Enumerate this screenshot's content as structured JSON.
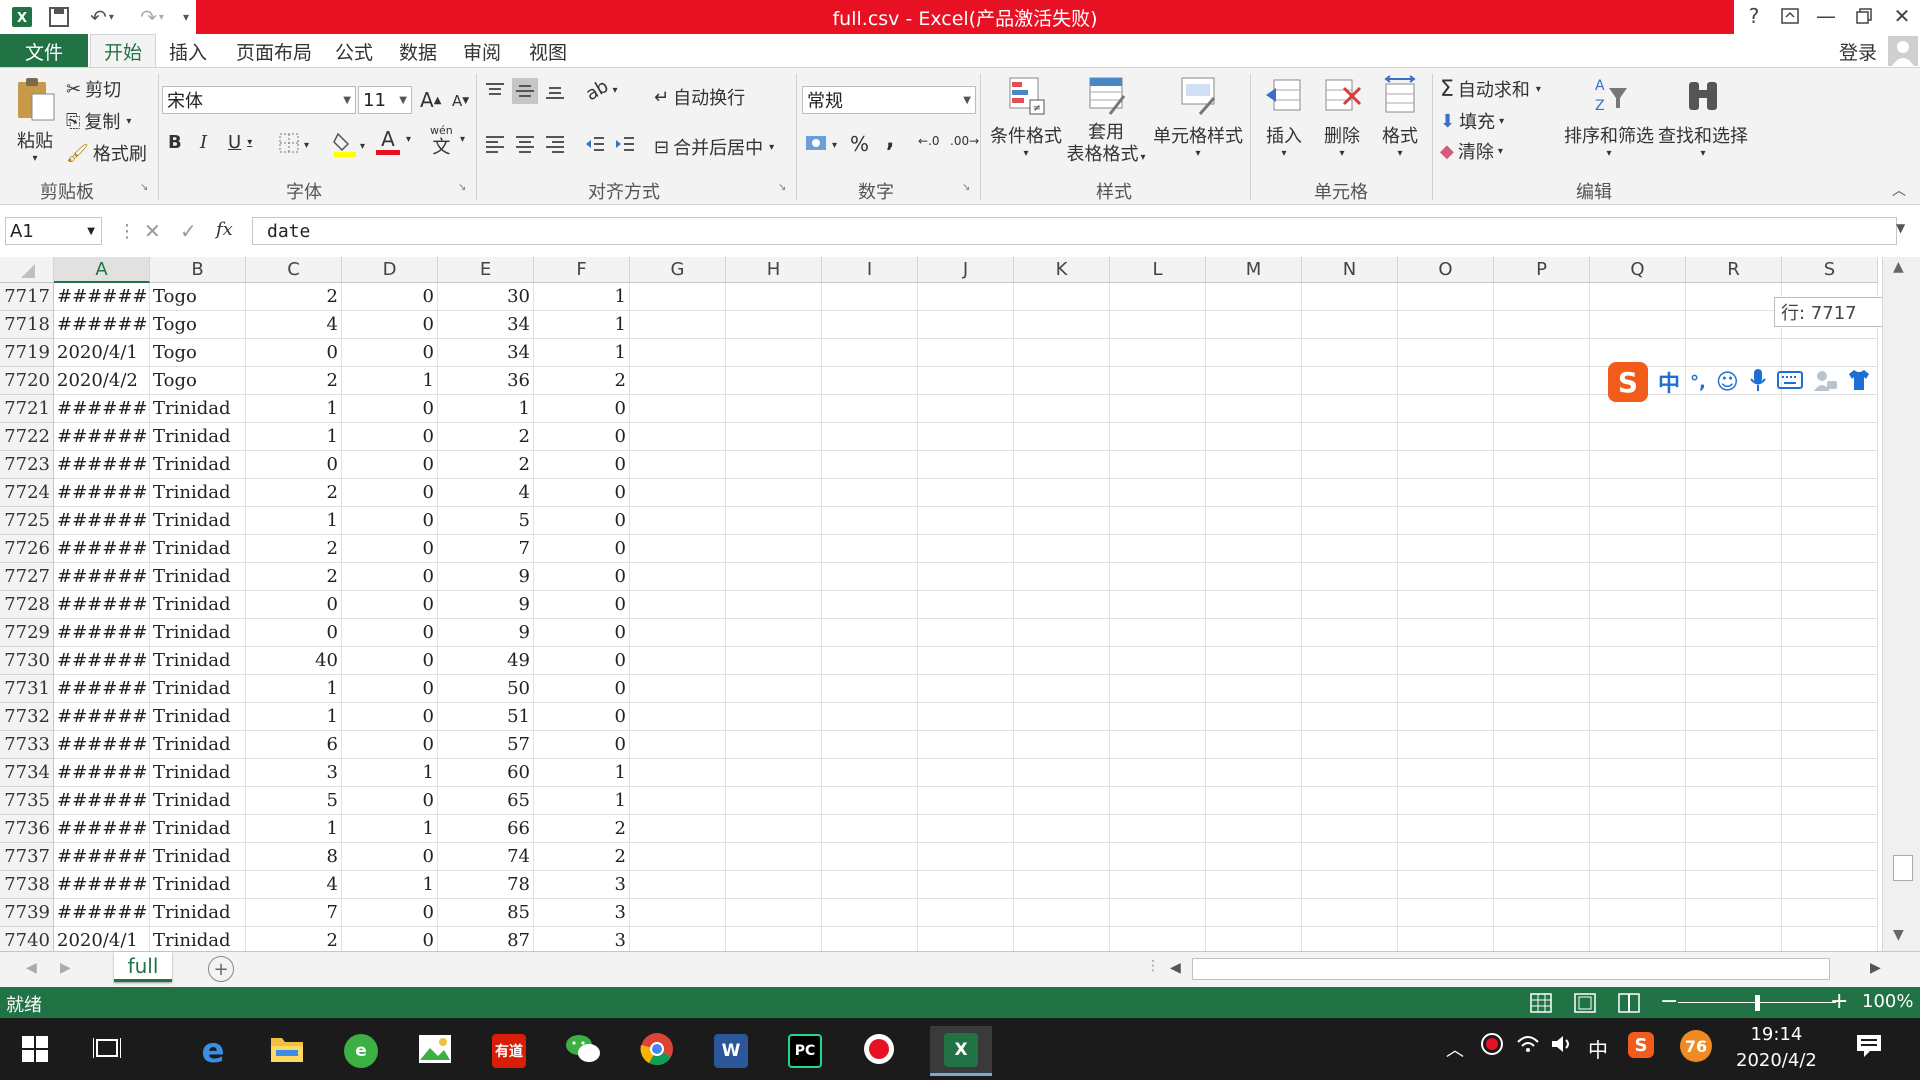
{
  "window": {
    "title": "full.csv -  Excel(产品激活失败)",
    "help": "?",
    "colors": {
      "title_bg": "#e81123",
      "excel_green": "#217346"
    }
  },
  "ribbon_tabs": [
    "文件",
    "开始",
    "插入",
    "页面布局",
    "公式",
    "数据",
    "审阅",
    "视图"
  ],
  "account": {
    "login_label": "登录"
  },
  "ribbon": {
    "clipboard": {
      "paste": "粘贴",
      "cut": "剪切",
      "copy": "复制",
      "format_painter": "格式刷",
      "group": "剪贴板"
    },
    "font": {
      "name": "宋体",
      "size": "11",
      "bold": "B",
      "italic": "I",
      "underline": "U",
      "grow": "A",
      "shrink": "A",
      "font_color": "A",
      "phonetic": "文",
      "phonetic_top": "wén",
      "group": "字体"
    },
    "alignment": {
      "wrap_text": "自动换行",
      "merge_center": "合并后居中",
      "group": "对齐方式"
    },
    "number": {
      "format": "常规",
      "percent": "%",
      "comma": ",",
      "group": "数字"
    },
    "styles": {
      "conditional": "条件格式",
      "table_line1": "套用",
      "table_line2": "表格格式",
      "cell_styles": "单元格样式",
      "group": "样式"
    },
    "cells": {
      "insert": "插入",
      "delete": "删除",
      "format": "格式",
      "group": "单元格"
    },
    "editing": {
      "autosum": "自动求和",
      "fill": "填充",
      "clear": "清除",
      "sort_filter": "排序和筛选",
      "find_select": "查找和选择",
      "group": "编辑"
    }
  },
  "formula_bar": {
    "name_box": "A1",
    "fx": "fx",
    "content": "date"
  },
  "columns": [
    "A",
    "B",
    "C",
    "D",
    "E",
    "F",
    "G",
    "H",
    "I",
    "J",
    "K",
    "L",
    "M",
    "N",
    "O",
    "P",
    "Q",
    "R",
    "S"
  ],
  "rows": [
    {
      "n": "7717",
      "a": "########",
      "b": "Togo",
      "c": "2",
      "d": "0",
      "e": "30",
      "f": "1"
    },
    {
      "n": "7718",
      "a": "########",
      "b": "Togo",
      "c": "4",
      "d": "0",
      "e": "34",
      "f": "1"
    },
    {
      "n": "7719",
      "a": "2020/4/1",
      "b": "Togo",
      "c": "0",
      "d": "0",
      "e": "34",
      "f": "1"
    },
    {
      "n": "7720",
      "a": "2020/4/2",
      "b": "Togo",
      "c": "2",
      "d": "1",
      "e": "36",
      "f": "2"
    },
    {
      "n": "7721",
      "a": "########",
      "b": "Trinidad",
      "c": "1",
      "d": "0",
      "e": "1",
      "f": "0"
    },
    {
      "n": "7722",
      "a": "########",
      "b": "Trinidad",
      "c": "1",
      "d": "0",
      "e": "2",
      "f": "0"
    },
    {
      "n": "7723",
      "a": "########",
      "b": "Trinidad",
      "c": "0",
      "d": "0",
      "e": "2",
      "f": "0"
    },
    {
      "n": "7724",
      "a": "########",
      "b": "Trinidad",
      "c": "2",
      "d": "0",
      "e": "4",
      "f": "0"
    },
    {
      "n": "7725",
      "a": "########",
      "b": "Trinidad",
      "c": "1",
      "d": "0",
      "e": "5",
      "f": "0"
    },
    {
      "n": "7726",
      "a": "########",
      "b": "Trinidad",
      "c": "2",
      "d": "0",
      "e": "7",
      "f": "0"
    },
    {
      "n": "7727",
      "a": "########",
      "b": "Trinidad",
      "c": "2",
      "d": "0",
      "e": "9",
      "f": "0"
    },
    {
      "n": "7728",
      "a": "########",
      "b": "Trinidad",
      "c": "0",
      "d": "0",
      "e": "9",
      "f": "0"
    },
    {
      "n": "7729",
      "a": "########",
      "b": "Trinidad",
      "c": "0",
      "d": "0",
      "e": "9",
      "f": "0"
    },
    {
      "n": "7730",
      "a": "########",
      "b": "Trinidad",
      "c": "40",
      "d": "0",
      "e": "49",
      "f": "0"
    },
    {
      "n": "7731",
      "a": "########",
      "b": "Trinidad",
      "c": "1",
      "d": "0",
      "e": "50",
      "f": "0"
    },
    {
      "n": "7732",
      "a": "########",
      "b": "Trinidad",
      "c": "1",
      "d": "0",
      "e": "51",
      "f": "0"
    },
    {
      "n": "7733",
      "a": "########",
      "b": "Trinidad",
      "c": "6",
      "d": "0",
      "e": "57",
      "f": "0"
    },
    {
      "n": "7734",
      "a": "########",
      "b": "Trinidad",
      "c": "3",
      "d": "1",
      "e": "60",
      "f": "1"
    },
    {
      "n": "7735",
      "a": "########",
      "b": "Trinidad",
      "c": "5",
      "d": "0",
      "e": "65",
      "f": "1"
    },
    {
      "n": "7736",
      "a": "########",
      "b": "Trinidad",
      "c": "1",
      "d": "1",
      "e": "66",
      "f": "2"
    },
    {
      "n": "7737",
      "a": "########",
      "b": "Trinidad",
      "c": "8",
      "d": "0",
      "e": "74",
      "f": "2"
    },
    {
      "n": "7738",
      "a": "########",
      "b": "Trinidad",
      "c": "4",
      "d": "1",
      "e": "78",
      "f": "3"
    },
    {
      "n": "7739",
      "a": "########",
      "b": "Trinidad",
      "c": "7",
      "d": "0",
      "e": "85",
      "f": "3"
    },
    {
      "n": "7740",
      "a": "2020/4/1",
      "b": "Trinidad",
      "c": "2",
      "d": "0",
      "e": "87",
      "f": "3"
    }
  ],
  "row_tooltip": "行: 7717",
  "ime_toolbar": {
    "logo": "S",
    "mode": "中",
    "punct": "°,"
  },
  "sheet_tabs": {
    "active": "full",
    "add": "+"
  },
  "status": {
    "ready": "就绪",
    "zoom": "100%",
    "minus": "−",
    "plus": "+",
    "zoom_level": 0.5
  },
  "taskbar": {
    "apps": [
      "start",
      "task-view",
      "edge",
      "file-explorer",
      "360-browser",
      "image-viewer",
      "youdao",
      "wechat",
      "chrome",
      "word",
      "pycharm",
      "recorder",
      "excel"
    ],
    "youdao_label": "有道",
    "pycharm_label": "PC",
    "tray_ime": "中",
    "badge": "76",
    "time": "19:14",
    "date": "2020/4/2"
  }
}
